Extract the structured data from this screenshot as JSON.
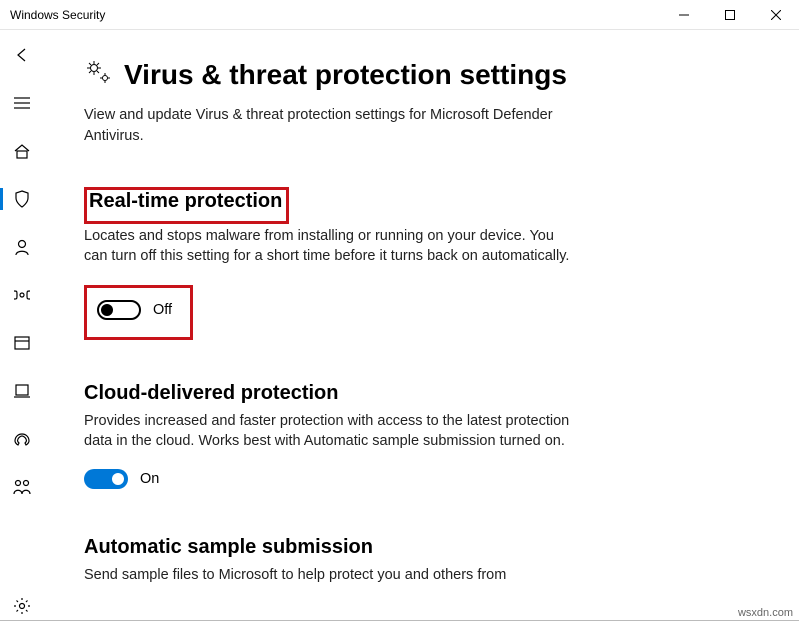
{
  "window": {
    "title": "Windows Security"
  },
  "page": {
    "title": "Virus & threat protection settings",
    "subtitle": "View and update Virus & threat protection settings for Microsoft Defender Antivirus."
  },
  "sections": {
    "realtime": {
      "title": "Real-time protection",
      "desc": "Locates and stops malware from installing or running on your device. You can turn off this setting for a short time before it turns back on automatically.",
      "toggle_state": "Off"
    },
    "cloud": {
      "title": "Cloud-delivered protection",
      "desc": "Provides increased and faster protection with access to the latest protection data in the cloud. Works best with Automatic sample submission turned on.",
      "toggle_state": "On"
    },
    "auto_sample": {
      "title": "Automatic sample submission",
      "desc": "Send sample files to Microsoft to help protect you and others from"
    }
  },
  "watermark": "wsxdn.com"
}
